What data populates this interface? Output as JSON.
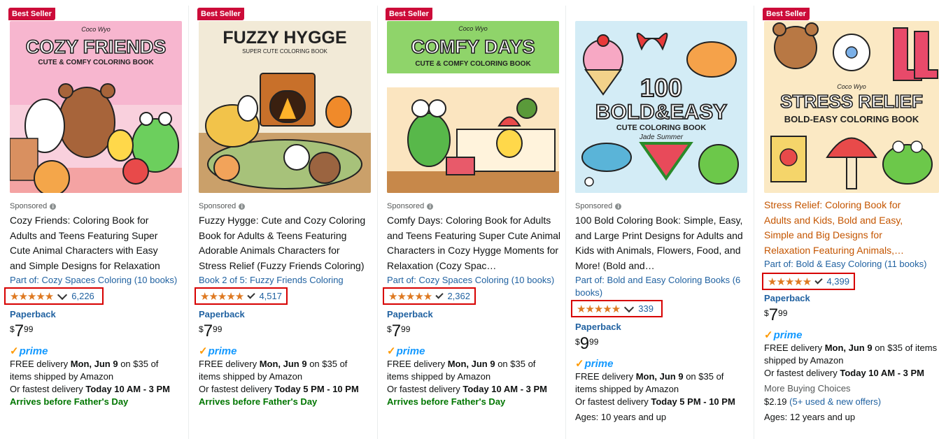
{
  "cards": [
    {
      "badge": "Best Seller",
      "sponsored": "Sponsored",
      "cover_title": "COZY FRIENDS",
      "cover_subtitle": "CUTE & COMFY COLORING BOOK",
      "cover_brand": "Coco Wyo",
      "title": "Cozy Friends: Coloring Book for Adults and Teens Featuring Super Cute Animal Characters with Easy and Simple Designs for Relaxation",
      "series": "Part of: Cozy Spaces Coloring (10 books)",
      "rating": "★★★★★",
      "rating_value": 4.8,
      "rating_count": "6,226",
      "format": "Paperback",
      "price_symbol": "$",
      "price_whole": "7",
      "price_fraction": "99",
      "prime": "prime",
      "delivery_prefix": "FREE delivery ",
      "delivery_date": "Mon, Jun 9",
      "delivery_suffix": " on $35 of items shipped by Amazon",
      "fastest_prefix": "Or fastest delivery ",
      "fastest_time": "Today 10 AM - 3 PM",
      "arrives": "Arrives before Father's Day"
    },
    {
      "badge": "Best Seller",
      "sponsored": "Sponsored",
      "cover_title": "FUZZY HYGGE",
      "cover_subtitle": "SUPER CUTE COLORING BOOK",
      "title": "Fuzzy Hygge: Cute and Cozy Coloring Book for Adults & Teens Featuring Adorable Animals Characters for Stress Relief (Fuzzy Friends Coloring)",
      "series": "Book 2 of 5: Fuzzy Friends Coloring",
      "rating": "★★★★★",
      "rating_value": 4.8,
      "rating_count": "4,517",
      "format": "Paperback",
      "price_symbol": "$",
      "price_whole": "7",
      "price_fraction": "99",
      "prime": "prime",
      "delivery_prefix": "FREE delivery ",
      "delivery_date": "Mon, Jun 9",
      "delivery_suffix": " on $35 of items shipped by Amazon",
      "fastest_prefix": "Or fastest delivery ",
      "fastest_time": "Today 5 PM - 10 PM",
      "arrives": "Arrives before Father's Day"
    },
    {
      "badge": "Best Seller",
      "sponsored": "Sponsored",
      "cover_title": "COMFY DAYS",
      "cover_subtitle": "CUTE & COMFY COLORING BOOK",
      "cover_brand": "Coco Wyo",
      "title": "Comfy Days: Coloring Book for Adults and Teens Featuring Super Cute Animal Characters in Cozy Hygge Moments for Relaxation (Cozy Spac…",
      "series": "Part of: Cozy Spaces Coloring (10 books)",
      "rating": "★★★★★",
      "rating_value": 4.8,
      "rating_count": "2,362",
      "format": "Paperback",
      "price_symbol": "$",
      "price_whole": "7",
      "price_fraction": "99",
      "prime": "prime",
      "delivery_prefix": "FREE delivery ",
      "delivery_date": "Mon, Jun 9",
      "delivery_suffix": " on $35 of items shipped by Amazon",
      "fastest_prefix": "Or fastest delivery ",
      "fastest_time": "Today 10 AM - 3 PM",
      "arrives": "Arrives before Father's Day"
    },
    {
      "sponsored": "Sponsored",
      "cover_title_1": "100",
      "cover_title_2": "BOLD&EASY",
      "cover_subtitle": "CUTE COLORING BOOK",
      "cover_author": "Jade Summer",
      "title": "100 Bold Coloring Book: Simple, Easy, and Large Print Designs for Adults and Kids with Animals, Flowers, Food, and More! (Bold and…",
      "series": "Part of: Bold and Easy Coloring Books (6 books)",
      "rating": "★★★★★",
      "rating_value": 4.8,
      "rating_count": "339",
      "format": "Paperback",
      "price_symbol": "$",
      "price_whole": "9",
      "price_fraction": "99",
      "prime": "prime",
      "delivery_prefix": "FREE delivery ",
      "delivery_date": "Mon, Jun 9",
      "delivery_suffix": " on $35 of items shipped by Amazon",
      "fastest_prefix": "Or fastest delivery ",
      "fastest_time": "Today 5 PM - 10 PM",
      "ages": "Ages: 10 years and up"
    },
    {
      "badge": "Best Seller",
      "cover_title_1": "STRESS RELIEF",
      "cover_subtitle": "BOLD-EASY COLORING BOOK",
      "cover_brand": "Coco Wyo",
      "title": "Stress Relief: Coloring Book for Adults and Kids, Bold and Easy, Simple and Big Designs for Relaxation Featuring Animals,…",
      "series": "Part of: Bold & Easy Coloring (11 books)",
      "rating": "★★★★★",
      "rating_value": 4.8,
      "rating_count": "4,399",
      "format": "Paperback",
      "price_symbol": "$",
      "price_whole": "7",
      "price_fraction": "99",
      "prime": "prime",
      "delivery_prefix": "FREE delivery ",
      "delivery_date": "Mon, Jun 9",
      "delivery_suffix": " on $35 of items shipped by Amazon",
      "fastest_prefix": "Or fastest delivery ",
      "fastest_time": "Today 10 AM - 3 PM",
      "more_buying": "More Buying Choices",
      "used_price": "$2.19",
      "used_offers": "(5+ used & new offers)",
      "ages": "Ages: 12 years and up"
    }
  ],
  "colors": {
    "badge": "#cc0c39",
    "link": "#2162a1",
    "star": "#de7921",
    "highlight_box": "#d70000",
    "arrives": "#007600",
    "prime": "#1399ff",
    "title_orange": "#c45500"
  }
}
